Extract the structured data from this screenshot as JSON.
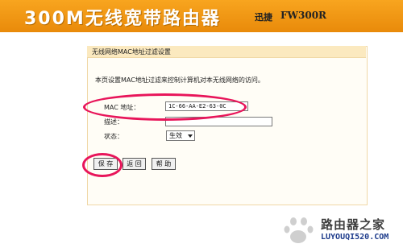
{
  "header": {
    "title": "300M无线宽带路由器",
    "brand": "迅捷",
    "model": "FW300R",
    "bg_color": "#f29a14"
  },
  "panel": {
    "title": "无线网络MAC地址过滤设置",
    "description": "本页设置MAC地址过滤来控制计算机对本无线网络的访问。",
    "fields": {
      "mac_label": "MAC 地址：",
      "mac_value": "1C-66-AA-E2-63-0C",
      "desc_label": "描述：",
      "desc_value": "",
      "status_label": "状态：",
      "status_value": "生效"
    },
    "buttons": {
      "save": "保 存",
      "back": "返 回",
      "help": "帮 助"
    }
  },
  "highlight_color": "#e8155a",
  "watermark": {
    "title": "路由器之家",
    "url": "LUYOUQI520.COM"
  }
}
